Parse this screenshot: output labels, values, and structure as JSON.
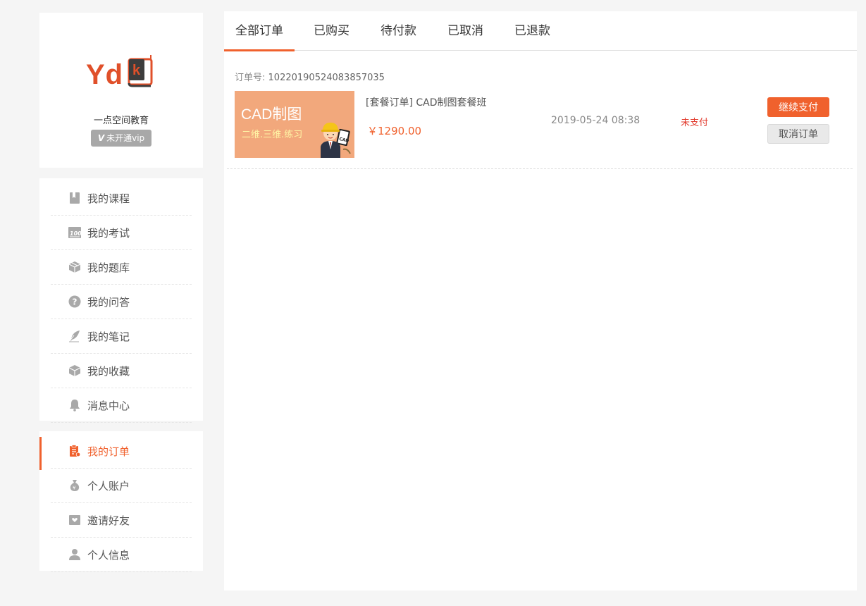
{
  "profile": {
    "logo_text": "Yd",
    "logo_book_letter": "k",
    "school_name": "一点空间教育",
    "vip_badge_icon": "V",
    "vip_badge_text": "未开通vip"
  },
  "sidebar": {
    "menu_top": [
      {
        "label": "我的课程",
        "icon": "bookmark-icon"
      },
      {
        "label": "我的考试",
        "icon": "score-100-icon"
      },
      {
        "label": "我的题库",
        "icon": "cube-icon"
      },
      {
        "label": "我的问答",
        "icon": "question-icon"
      },
      {
        "label": "我的笔记",
        "icon": "quill-icon"
      },
      {
        "label": "我的收藏",
        "icon": "box-icon"
      },
      {
        "label": "消息中心",
        "icon": "bell-icon"
      }
    ],
    "menu_bottom": [
      {
        "label": "我的订单",
        "icon": "order-icon",
        "active": true
      },
      {
        "label": "个人账户",
        "icon": "money-bag-icon"
      },
      {
        "label": "邀请好友",
        "icon": "invite-icon"
      },
      {
        "label": "个人信息",
        "icon": "user-icon"
      }
    ]
  },
  "tabs": [
    {
      "label": "全部订单",
      "active": true
    },
    {
      "label": "已购买"
    },
    {
      "label": "待付款"
    },
    {
      "label": "已取消"
    },
    {
      "label": "已退款"
    }
  ],
  "order": {
    "number_label": "订单号:",
    "number": "10220190524083857035",
    "thumb_title": "CAD制图",
    "thumb_subtitle": "二维.三维.练习",
    "course_name": "[套餐订单] CAD制图套餐班",
    "price": "￥1290.00",
    "time": "2019-05-24 08:38",
    "status": "未支付",
    "pay_label": "继续支付",
    "cancel_label": "取消订单"
  },
  "colors": {
    "accent": "#f0612d",
    "status_unpaid": "#e23b2e",
    "thumb_bg": "#f2a87c"
  }
}
